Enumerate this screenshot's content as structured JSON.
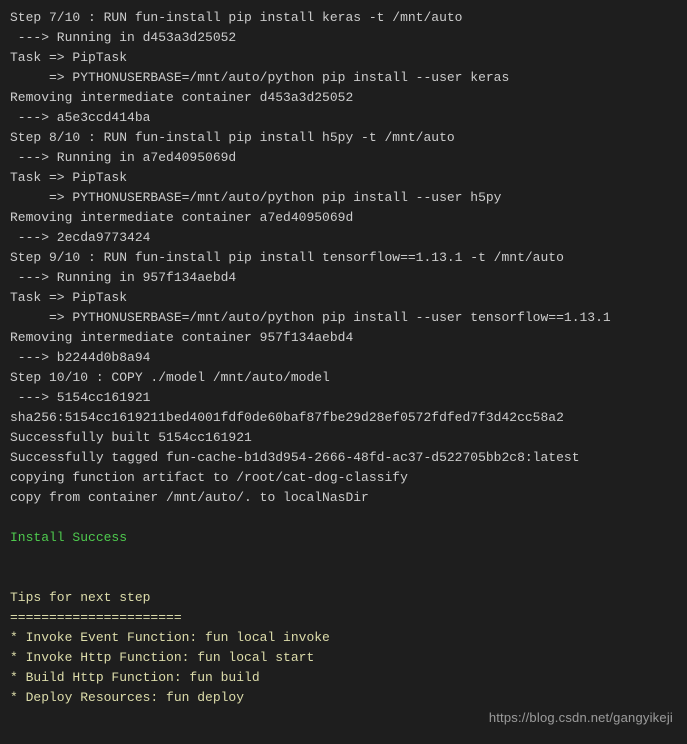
{
  "terminal": {
    "lines": [
      {
        "t": "Step 7/10 : RUN fun-install pip install keras -t /mnt/auto",
        "c": ""
      },
      {
        "t": " ---> Running in d453a3d25052",
        "c": ""
      },
      {
        "t": "Task => PipTask",
        "c": ""
      },
      {
        "t": "     => PYTHONUSERBASE=/mnt/auto/python pip install --user keras",
        "c": ""
      },
      {
        "t": "Removing intermediate container d453a3d25052",
        "c": ""
      },
      {
        "t": " ---> a5e3ccd414ba",
        "c": ""
      },
      {
        "t": "Step 8/10 : RUN fun-install pip install h5py -t /mnt/auto",
        "c": ""
      },
      {
        "t": " ---> Running in a7ed4095069d",
        "c": ""
      },
      {
        "t": "Task => PipTask",
        "c": ""
      },
      {
        "t": "     => PYTHONUSERBASE=/mnt/auto/python pip install --user h5py",
        "c": ""
      },
      {
        "t": "Removing intermediate container a7ed4095069d",
        "c": ""
      },
      {
        "t": " ---> 2ecda9773424",
        "c": ""
      },
      {
        "t": "Step 9/10 : RUN fun-install pip install tensorflow==1.13.1 -t /mnt/auto",
        "c": ""
      },
      {
        "t": " ---> Running in 957f134aebd4",
        "c": ""
      },
      {
        "t": "Task => PipTask",
        "c": ""
      },
      {
        "t": "     => PYTHONUSERBASE=/mnt/auto/python pip install --user tensorflow==1.13.1",
        "c": ""
      },
      {
        "t": "Removing intermediate container 957f134aebd4",
        "c": ""
      },
      {
        "t": " ---> b2244d0b8a94",
        "c": ""
      },
      {
        "t": "Step 10/10 : COPY ./model /mnt/auto/model",
        "c": ""
      },
      {
        "t": " ---> 5154cc161921",
        "c": ""
      },
      {
        "t": "sha256:5154cc1619211bed4001fdf0de60baf87fbe29d28ef0572fdfed7f3d42cc58a2",
        "c": ""
      },
      {
        "t": "Successfully built 5154cc161921",
        "c": ""
      },
      {
        "t": "Successfully tagged fun-cache-b1d3d954-2666-48fd-ac37-d522705bb2c8:latest",
        "c": ""
      },
      {
        "t": "copying function artifact to /root/cat-dog-classify",
        "c": ""
      },
      {
        "t": "copy from container /mnt/auto/. to localNasDir",
        "c": ""
      },
      {
        "t": "",
        "c": ""
      },
      {
        "t": "Install Success",
        "c": "green"
      },
      {
        "t": "",
        "c": ""
      },
      {
        "t": "",
        "c": ""
      },
      {
        "t": "Tips for next step",
        "c": "yellow"
      },
      {
        "t": "======================",
        "c": "yellow"
      },
      {
        "t": "* Invoke Event Function: fun local invoke",
        "c": "yellow"
      },
      {
        "t": "* Invoke Http Function: fun local start",
        "c": "yellow"
      },
      {
        "t": "* Build Http Function: fun build",
        "c": "yellow"
      },
      {
        "t": "* Deploy Resources: fun deploy",
        "c": "yellow"
      }
    ]
  },
  "watermark": "https://blog.csdn.net/gangyikeji"
}
